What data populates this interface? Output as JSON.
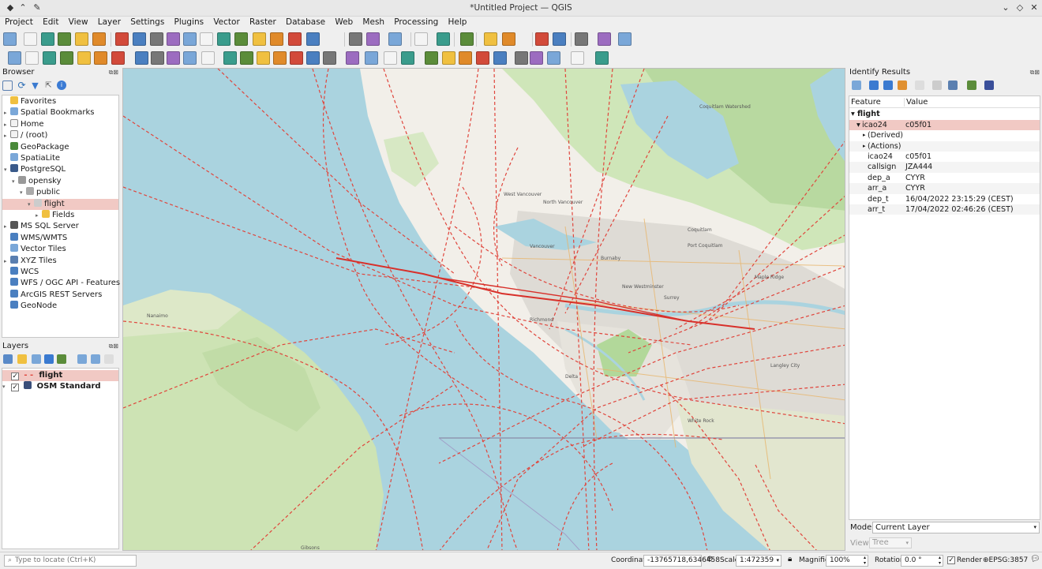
{
  "window": {
    "title": "*Untitled Project — QGIS"
  },
  "menu": [
    "Project",
    "Edit",
    "View",
    "Layer",
    "Settings",
    "Plugins",
    "Vector",
    "Raster",
    "Database",
    "Web",
    "Mesh",
    "Processing",
    "Help"
  ],
  "browser": {
    "title": "Browser",
    "items": [
      {
        "label": "Favorites",
        "icon": "star-icon",
        "indent": 0,
        "arrow": ""
      },
      {
        "label": "Spatial Bookmarks",
        "icon": "bookmark-icon",
        "indent": 0,
        "arrow": "▸"
      },
      {
        "label": "Home",
        "icon": "folder-icon",
        "indent": 0,
        "arrow": "▸"
      },
      {
        "label": "/ (root)",
        "icon": "folder-icon",
        "indent": 0,
        "arrow": "▸"
      },
      {
        "label": "GeoPackage",
        "icon": "geopackage-icon",
        "indent": 0,
        "arrow": ""
      },
      {
        "label": "SpatiaLite",
        "icon": "spatialite-icon",
        "indent": 0,
        "arrow": ""
      },
      {
        "label": "PostgreSQL",
        "icon": "postgresql-icon",
        "indent": 0,
        "arrow": "▾"
      },
      {
        "label": "opensky",
        "icon": "connection-icon",
        "indent": 1,
        "arrow": "▾"
      },
      {
        "label": "public",
        "icon": "schema-icon",
        "indent": 2,
        "arrow": "▾"
      },
      {
        "label": "flight",
        "icon": "line-layer-icon",
        "indent": 3,
        "arrow": "▾"
      },
      {
        "label": "Fields",
        "icon": "fields-icon",
        "indent": 4,
        "arrow": "▸"
      },
      {
        "label": "MS SQL Server",
        "icon": "mssql-icon",
        "indent": 0,
        "arrow": "▸"
      },
      {
        "label": "WMS/WMTS",
        "icon": "wms-icon",
        "indent": 0,
        "arrow": ""
      },
      {
        "label": "Vector Tiles",
        "icon": "vector-tiles-icon",
        "indent": 0,
        "arrow": ""
      },
      {
        "label": "XYZ Tiles",
        "icon": "xyz-tiles-icon",
        "indent": 0,
        "arrow": "▸"
      },
      {
        "label": "WCS",
        "icon": "wcs-icon",
        "indent": 0,
        "arrow": ""
      },
      {
        "label": "WFS / OGC API - Features",
        "icon": "wfs-icon",
        "indent": 0,
        "arrow": ""
      },
      {
        "label": "ArcGIS REST Servers",
        "icon": "arcgis-icon",
        "indent": 0,
        "arrow": ""
      },
      {
        "label": "GeoNode",
        "icon": "geonode-icon",
        "indent": 0,
        "arrow": ""
      }
    ]
  },
  "layers": {
    "title": "Layers",
    "items": [
      {
        "label": "flight",
        "checked": true,
        "selected": true
      },
      {
        "label": "OSM Standard",
        "checked": true,
        "selected": false
      }
    ]
  },
  "identify": {
    "title": "Identify Results",
    "col_feature": "Feature",
    "col_value": "Value",
    "layer_name": "flight",
    "feature_key": "icao24",
    "feature_val": "c05f01",
    "derived": "(Derived)",
    "actions": "(Actions)",
    "attributes": [
      {
        "field": "icao24",
        "value": "c05f01"
      },
      {
        "field": "callsign",
        "value": "JZA444"
      },
      {
        "field": "dep_a",
        "value": "CYYR"
      },
      {
        "field": "arr_a",
        "value": "CYYR"
      },
      {
        "field": "dep_t",
        "value": "16/04/2022 23:15:29 (CEST)"
      },
      {
        "field": "arr_t",
        "value": "17/04/2022 02:46:26 (CEST)"
      }
    ],
    "mode_label": "Mode",
    "mode_value": "Current Layer",
    "view_label": "View",
    "view_value": "Tree"
  },
  "map": {
    "place_labels": [
      "West Vancouver",
      "North Vancouver",
      "Vancouver",
      "Burnaby",
      "Coquitlam",
      "Port Coquitlam",
      "New Westminster",
      "Surrey",
      "Maple Ridge",
      "Richmond",
      "Delta",
      "Langley City",
      "White Rock",
      "Nanaimo",
      "Gibsons",
      "Coquitlam Watershed"
    ]
  },
  "status": {
    "locate_placeholder": "Type to locate (Ctrl+K)",
    "coordinate_label": "Coordinate",
    "coordinate_value": "-13765718,6346458",
    "scale_label": "Scale",
    "scale_value": "1:472359",
    "magnifier_label": "Magnifier",
    "magnifier_value": "100%",
    "rotation_label": "Rotation",
    "rotation_value": "0.0 °",
    "render_label": "Render",
    "crs_label": "EPSG:3857"
  },
  "colors": {
    "selection": "#f1c9c4",
    "flight_line": "#e0453c",
    "water": "#aad3df",
    "land": "#f2efe9"
  }
}
